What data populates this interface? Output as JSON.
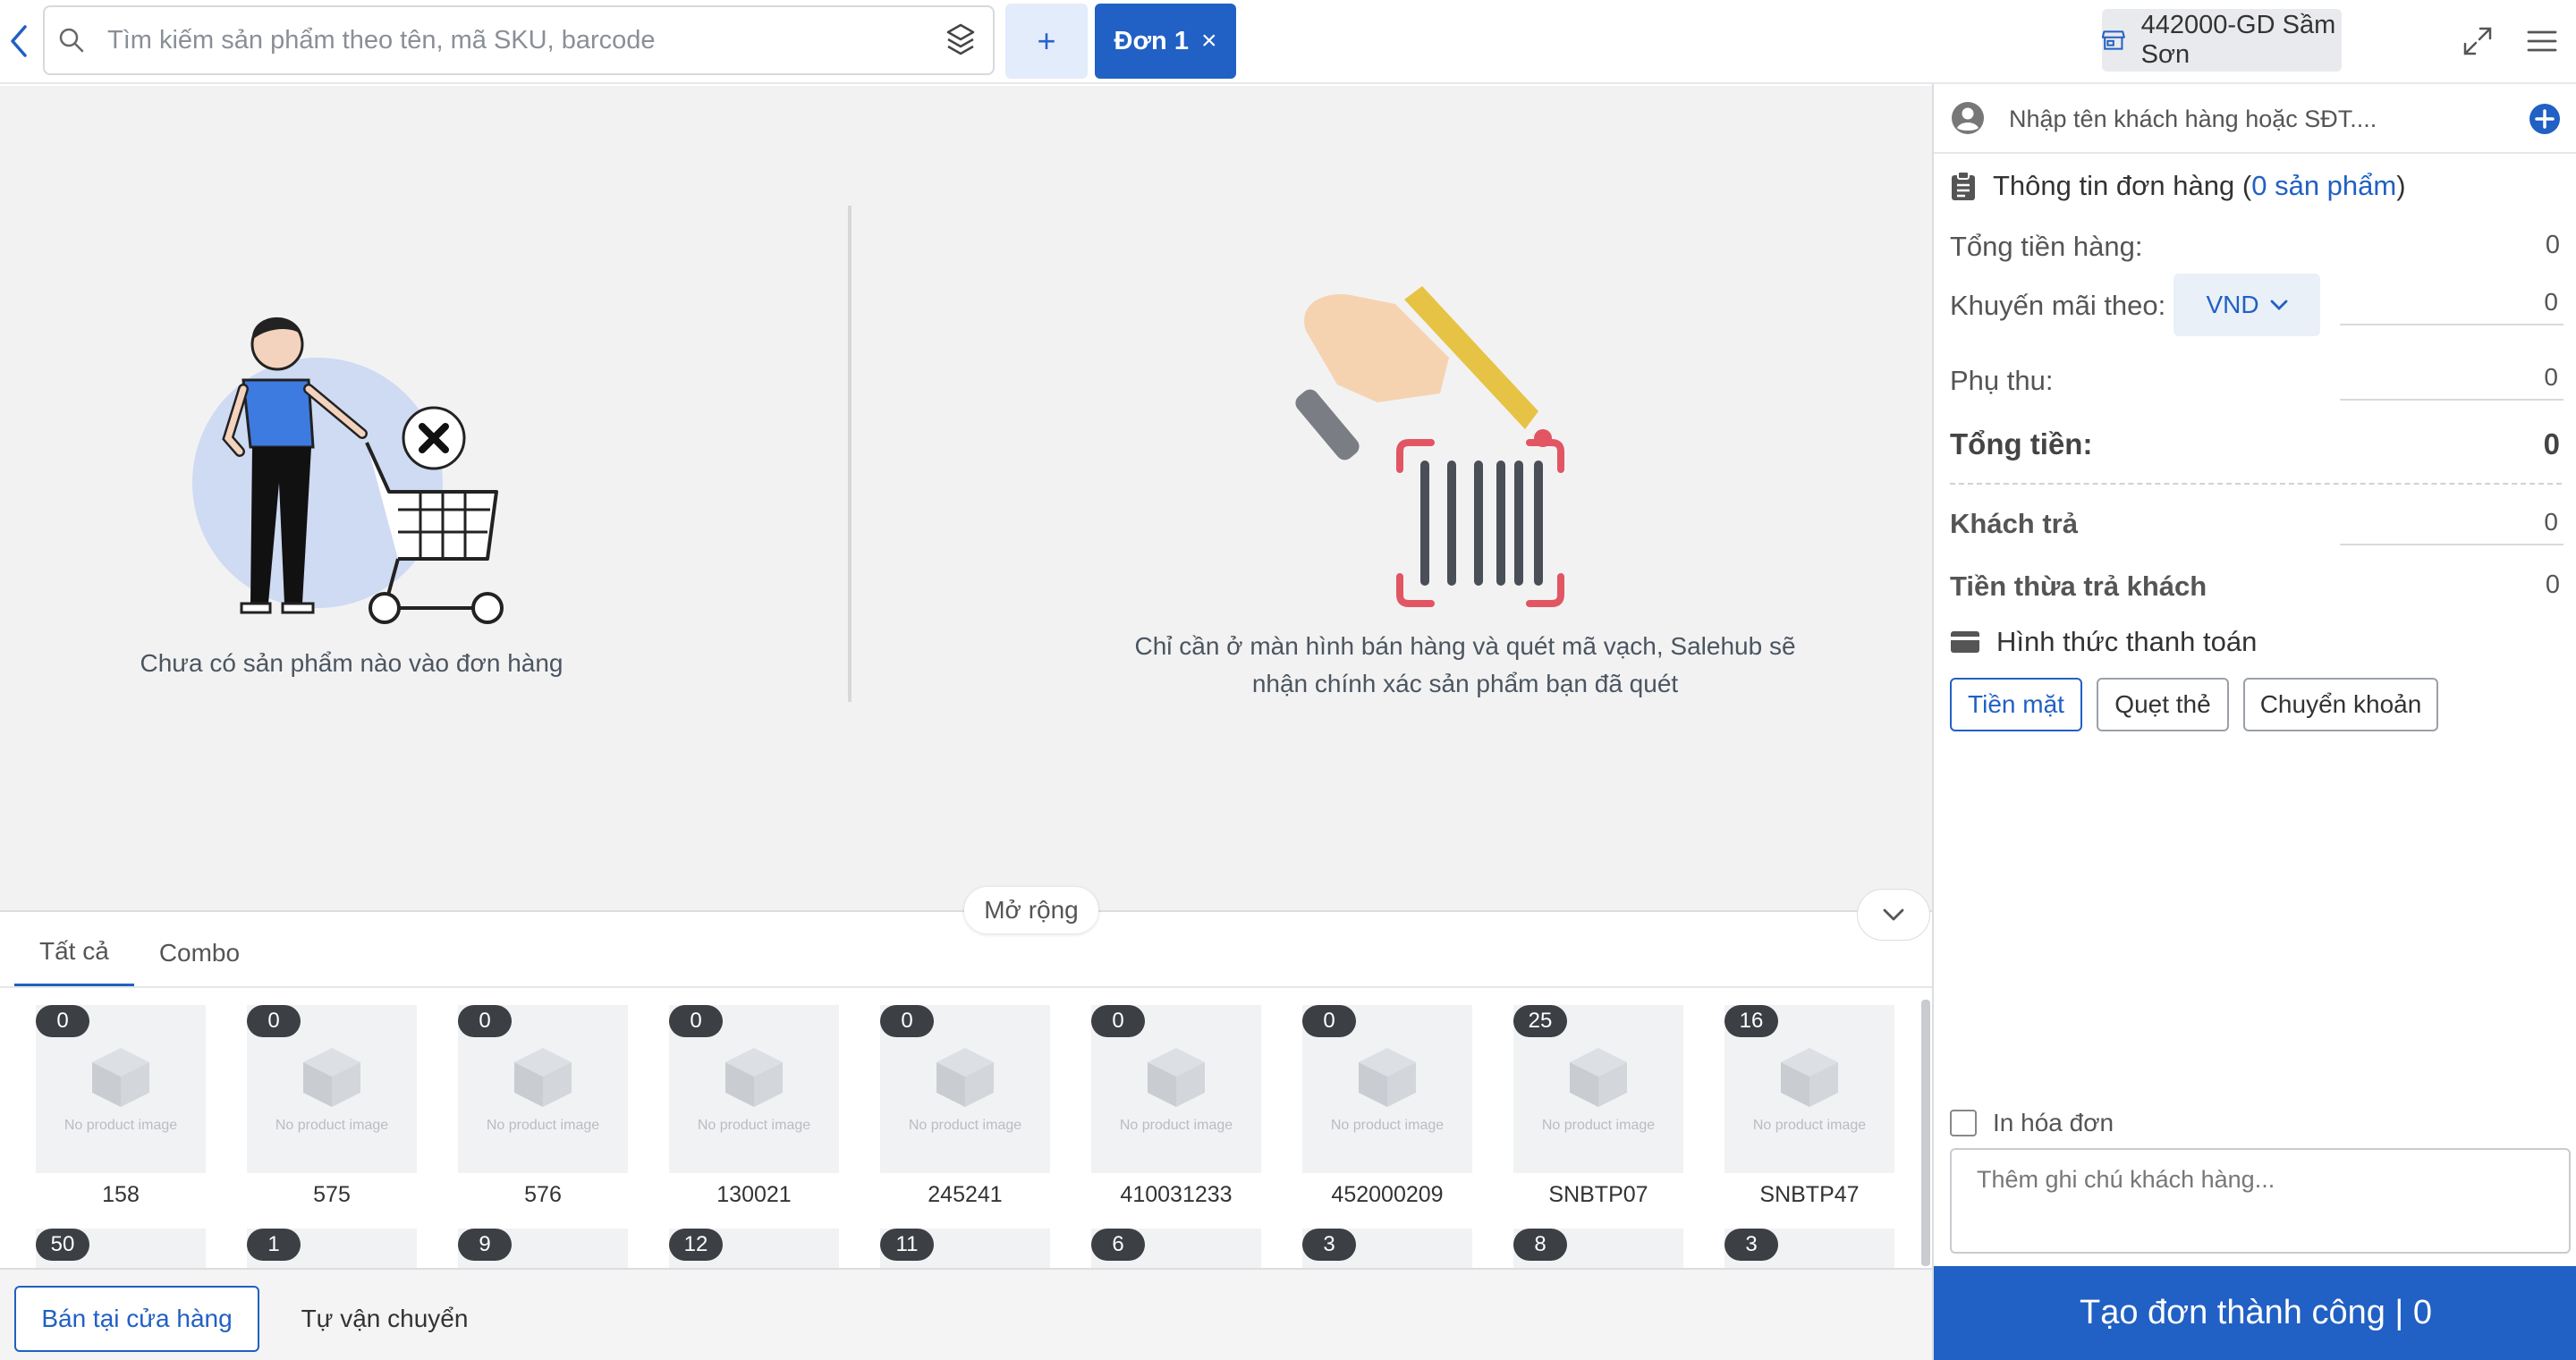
{
  "header": {
    "search_placeholder": "Tìm kiếm sản phẩm theo tên, mã SKU, barcode",
    "add_tab_label": "+",
    "order_tab_label": "Đơn 1",
    "order_tab_close": "×",
    "store_label": "442000-GD Sầm Sơn"
  },
  "empty_state": {
    "no_products_text": "Chưa có sản phẩm nào vào đơn hàng",
    "scan_text_line1": "Chỉ cần ở màn hình bán hàng và quét mã vạch, Salehub sẽ",
    "scan_text_line2": "nhận chính xác sản phẩm bạn đã quét",
    "expand_label": "Mở rộng"
  },
  "products": {
    "tabs": [
      {
        "label": "Tất cả",
        "active": true
      },
      {
        "label": "Combo",
        "active": false
      }
    ],
    "no_image_text": "No product image",
    "row1": [
      {
        "badge": "0",
        "name": "158"
      },
      {
        "badge": "0",
        "name": "575"
      },
      {
        "badge": "0",
        "name": "576"
      },
      {
        "badge": "0",
        "name": "130021"
      },
      {
        "badge": "0",
        "name": "245241"
      },
      {
        "badge": "0",
        "name": "410031233"
      },
      {
        "badge": "0",
        "name": "452000209"
      },
      {
        "badge": "25",
        "name": "SNBTP07"
      },
      {
        "badge": "16",
        "name": "SNBTP47"
      }
    ],
    "row2_badges": [
      "50",
      "1",
      "9",
      "12",
      "11",
      "6",
      "3",
      "8",
      "3"
    ]
  },
  "bottom": {
    "mode_store": "Bán tại cửa hàng",
    "mode_ship": "Tự vận chuyển"
  },
  "order_panel": {
    "customer_placeholder": "Nhập tên khách hàng hoặc SĐT....",
    "info_title": "Thông tin đơn hàng",
    "info_paren_open": "(",
    "info_count": "0 sản phẩm",
    "info_paren_close": ")",
    "subtotal_label": "Tổng tiền hàng:",
    "subtotal_value": "0",
    "discount_label": "Khuyến mãi theo:",
    "discount_unit": "VND",
    "discount_value": "0",
    "surcharge_label": "Phụ thu:",
    "surcharge_value": "0",
    "total_label": "Tổng tiền:",
    "total_value": "0",
    "paid_label": "Khách trả",
    "paid_value": "0",
    "change_label": "Tiền thừa trả khách",
    "change_value": "0",
    "payment_title": "Hình thức thanh toán",
    "payment_methods": [
      "Tiền mặt",
      "Quẹt thẻ",
      "Chuyển khoản"
    ],
    "print_label": "In hóa đơn",
    "note_placeholder": "Thêm ghi chú khách hàng...",
    "submit_label": "Tạo đơn thành công | 0"
  },
  "colors": {
    "primary": "#2160c4",
    "badge": "#3c3f44",
    "empty_bg": "#f2f2f3"
  }
}
